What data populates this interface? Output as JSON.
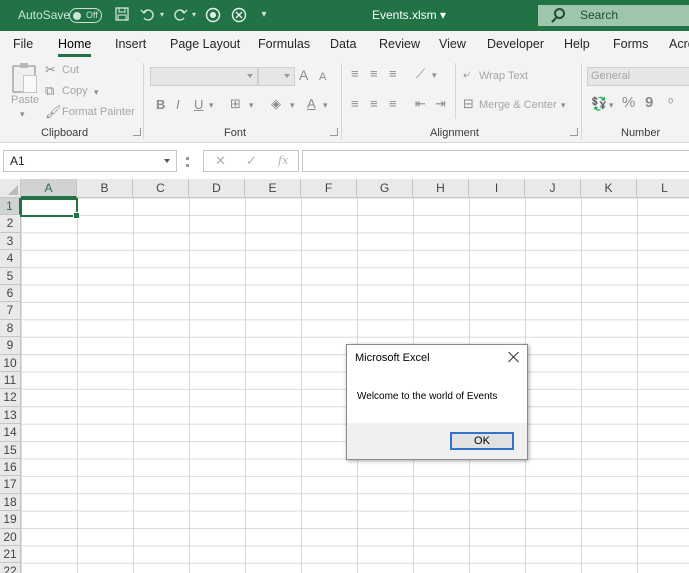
{
  "titlebar": {
    "autosave_label": "AutoSave",
    "autosave_state": "Off",
    "file_title": "Events.xlsm",
    "search_placeholder": "Search",
    "icons": [
      "save-icon",
      "undo-icon",
      "redo-icon",
      "record-icon",
      "clear-icon",
      "customize-icon"
    ]
  },
  "tabs": [
    "File",
    "Home",
    "Insert",
    "Page Layout",
    "Formulas",
    "Data",
    "Review",
    "View",
    "Developer",
    "Help",
    "Forms",
    "Acro"
  ],
  "active_tab": "Home",
  "ribbon": {
    "clipboard": {
      "paste": "Paste",
      "cut": "Cut",
      "copy": "Copy",
      "format_painter": "Format Painter",
      "label": "Clipboard"
    },
    "font": {
      "grow": "A",
      "shrink": "A",
      "bold": "B",
      "italic": "I",
      "underline": "U",
      "font_color": "A",
      "label": "Font"
    },
    "alignment": {
      "wrap_text": "Wrap Text",
      "merge_center": "Merge & Center",
      "label": "Alignment"
    },
    "number": {
      "format": "General",
      "percent": "%",
      "comma": "9",
      "label": "Number"
    }
  },
  "formula_bar": {
    "name_box": "A1",
    "cancel": "✕",
    "enter": "✓",
    "fx": "fx",
    "value": ""
  },
  "columns": [
    "A",
    "B",
    "C",
    "D",
    "E",
    "F",
    "G",
    "H",
    "I",
    "J",
    "K",
    "L"
  ],
  "rows": [
    "1",
    "2",
    "3",
    "4",
    "5",
    "6",
    "7",
    "8",
    "9",
    "10",
    "11",
    "12",
    "13",
    "14",
    "15",
    "16",
    "17",
    "18",
    "19",
    "20",
    "21",
    "22"
  ],
  "selected_cell": "A1",
  "dialog": {
    "title": "Microsoft Excel",
    "message": "Welcome to the world of Events",
    "ok_label": "OK"
  },
  "colors": {
    "excel_green": "#217346",
    "ok_focus": "#2f74d0"
  }
}
